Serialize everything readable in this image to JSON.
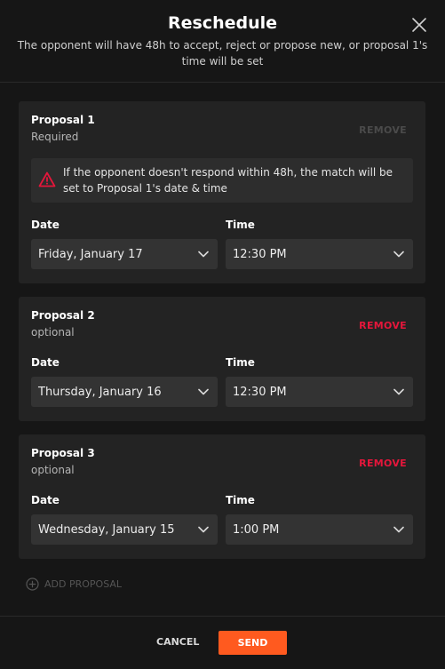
{
  "header": {
    "title": "Reschedule",
    "subtitle": "The opponent will have 48h to accept, reject or propose new, or proposal 1's time will be set"
  },
  "labels": {
    "date": "Date",
    "time": "Time"
  },
  "proposals": [
    {
      "title": "Proposal 1",
      "subtitle": "Required",
      "remove_label": "REMOVE",
      "remove_enabled": false,
      "warning": "If the opponent doesn't respond within 48h, the match will be set to Proposal 1's date & time",
      "date": "Friday, January 17",
      "time": "12:30 PM"
    },
    {
      "title": "Proposal 2",
      "subtitle": "optional",
      "remove_label": "REMOVE",
      "remove_enabled": true,
      "date": "Thursday, January 16",
      "time": "12:30 PM"
    },
    {
      "title": "Proposal 3",
      "subtitle": "optional",
      "remove_label": "REMOVE",
      "remove_enabled": true,
      "date": "Wednesday, January 15",
      "time": "1:00 PM"
    }
  ],
  "add_proposal_label": "ADD PROPOSAL",
  "footer": {
    "cancel_label": "CANCEL",
    "send_label": "SEND"
  },
  "colors": {
    "accent": "#ff5a1f",
    "remove": "#e5163b",
    "warning": "#e5163b"
  },
  "icons": {
    "close": "close-icon",
    "warning": "warning-triangle-icon",
    "chevron": "chevron-down-icon",
    "add": "plus-circle-icon"
  }
}
